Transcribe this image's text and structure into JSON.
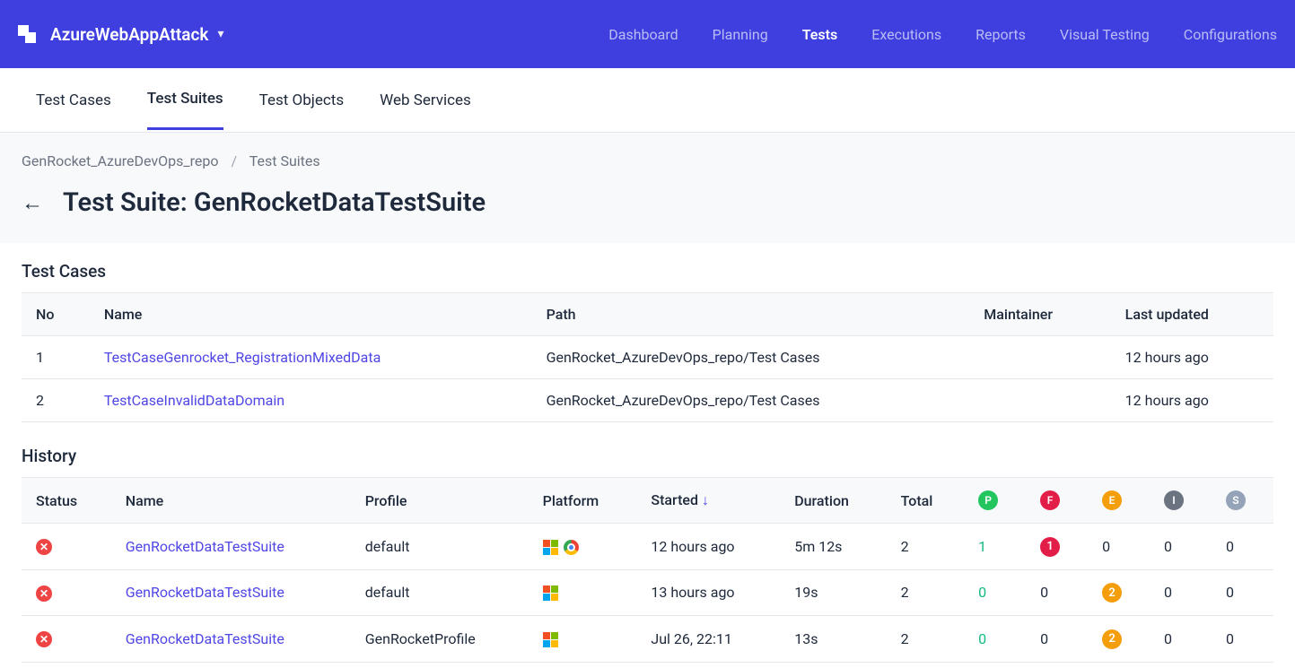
{
  "header": {
    "project": "AzureWebAppAttack",
    "nav": [
      "Dashboard",
      "Planning",
      "Tests",
      "Executions",
      "Reports",
      "Visual Testing",
      "Configurations"
    ],
    "activeNav": "Tests"
  },
  "subtabs": [
    "Test Cases",
    "Test Suites",
    "Test Objects",
    "Web Services"
  ],
  "activeSubtab": "Test Suites",
  "breadcrumb": {
    "repo": "GenRocket_AzureDevOps_repo",
    "section": "Test Suites"
  },
  "pageTitle": "Test Suite: GenRocketDataTestSuite",
  "testCases": {
    "title": "Test Cases",
    "columns": [
      "No",
      "Name",
      "Path",
      "Maintainer",
      "Last updated"
    ],
    "rows": [
      {
        "no": "1",
        "name": "TestCaseGenrocket_RegistrationMixedData",
        "path": "GenRocket_AzureDevOps_repo/Test Cases",
        "maintainer": "",
        "updated": "12 hours ago"
      },
      {
        "no": "2",
        "name": "TestCaseInvalidDataDomain",
        "path": "GenRocket_AzureDevOps_repo/Test Cases",
        "maintainer": "",
        "updated": "12 hours ago"
      }
    ]
  },
  "history": {
    "title": "History",
    "columns": {
      "status": "Status",
      "name": "Name",
      "profile": "Profile",
      "platform": "Platform",
      "started": "Started",
      "duration": "Duration",
      "total": "Total"
    },
    "pillLabels": {
      "P": "P",
      "F": "F",
      "E": "E",
      "I": "I",
      "S": "S"
    },
    "rows": [
      {
        "status": "fail",
        "name": "GenRocketDataTestSuite",
        "profile": "default",
        "platform": "win+chrome",
        "started": "12 hours ago",
        "duration": "5m 12s",
        "total": "2",
        "P": "1",
        "F": "1",
        "E": "0",
        "I": "0",
        "S": "0",
        "badges": {
          "F": true
        }
      },
      {
        "status": "fail",
        "name": "GenRocketDataTestSuite",
        "profile": "default",
        "platform": "win",
        "started": "13 hours ago",
        "duration": "19s",
        "total": "2",
        "P": "0",
        "F": "0",
        "E": "2",
        "I": "0",
        "S": "0",
        "badges": {
          "E": true
        }
      },
      {
        "status": "fail",
        "name": "GenRocketDataTestSuite",
        "profile": "GenRocketProfile",
        "platform": "win",
        "started": "Jul 26, 22:11",
        "duration": "13s",
        "total": "2",
        "P": "0",
        "F": "0",
        "E": "2",
        "I": "0",
        "S": "0",
        "badges": {
          "E": true
        }
      }
    ]
  }
}
